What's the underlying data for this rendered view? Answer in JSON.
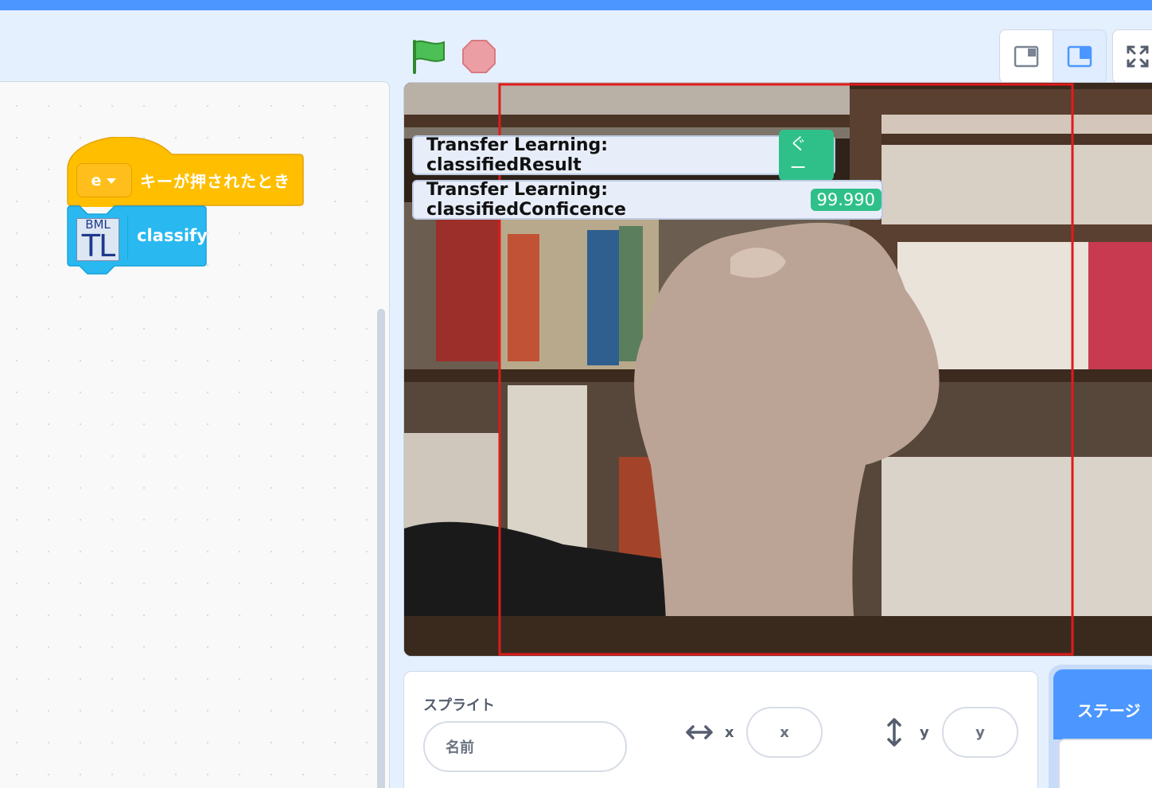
{
  "toolbar": {
    "green_flag_icon": "green-flag-icon",
    "stop_icon": "stop-icon",
    "layout_modes": [
      "small-stage-icon",
      "large-stage-icon"
    ],
    "fullscreen_icon": "fullscreen-icon"
  },
  "code_area": {
    "hat_block": {
      "key_value": "e",
      "label": "キーが押されたとき",
      "color": "#ffbf00"
    },
    "command_block": {
      "ext_icon_top": "BML",
      "ext_icon_bottom": "TL",
      "label": "classify",
      "color": "#29b8f0"
    }
  },
  "stage": {
    "monitors": [
      {
        "label": "Transfer Learning: classifiedResult",
        "value": "ぐー"
      },
      {
        "label": "Transfer Learning: classifiedConficence",
        "value": "99.990"
      }
    ],
    "box_color": "#e01b1b"
  },
  "sprite_info": {
    "title": "スプライト",
    "name_placeholder": "名前",
    "x_label": "x",
    "x_placeholder": "x",
    "y_label": "y",
    "y_placeholder": "y"
  },
  "stage_tab": {
    "label": "ステージ"
  },
  "colors": {
    "accent": "#4c97ff",
    "monitor_value": "#2fc08a"
  }
}
